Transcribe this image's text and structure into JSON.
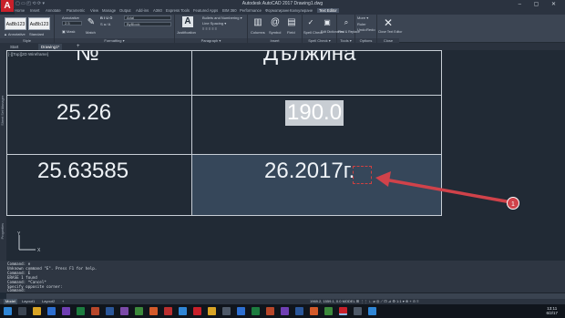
{
  "window": {
    "logo_letter": "A",
    "qat_text": "▢ ▭ ◰ ⟲ ⟳ ▾",
    "title": "Autodesk AutoCAD 2017   Drawing1.dwg",
    "controls": "– ▢ ✕"
  },
  "menu_tabs": [
    "Home",
    "Insert",
    "Annotate",
    "Parametric",
    "View",
    "Manage",
    "Output",
    "Add-ins",
    "A360",
    "Express Tools",
    "Featured Apps",
    "BIM 360",
    "Performance",
    "Форматиране",
    "Калкулиране",
    "Text Editor"
  ],
  "ribbon": {
    "style_boxes": [
      "AaBb123",
      "AaBb123"
    ],
    "style_under": [
      "▲ Annotative",
      "Standard"
    ],
    "style_panel": "Style",
    "annotative": "Annotative",
    "text_height": "2.5",
    "mask": "▣ Mask",
    "match_label": "Match",
    "font_combo": "Arial",
    "color_combo": "ByBlock",
    "formatting_panel": "Formatting ▾",
    "justification_label": "Justification",
    "bullets": "Bullets and Numbering ▾",
    "line_spacing": "Line Spacing ▾",
    "paragraph_panel": "Paragraph ▾",
    "columns_label": "Columns",
    "symbol_label": "Symbol",
    "field_label": "Field",
    "insert_panel": "Insert",
    "spell_check_label": "Spell Check",
    "dictionaries_label": "Edit Dictionaries",
    "spell_panel": "Spell Check ▾",
    "find_label": "Find & Replace",
    "tools_panel": "Tools ▾",
    "more_label": "More ▾",
    "ruler_label": "Ruler",
    "undo_label": "Undo",
    "redo_label": "Redo",
    "options_panel": "Options",
    "close_label": "Close Text Editor",
    "close_panel": "Close"
  },
  "file_tabs": [
    "Start",
    "Drawing1*"
  ],
  "viewport_label": "[-][Top][2D Wireframe]",
  "side_labels": [
    "Sheet Set Manager",
    "Properties"
  ],
  "table": {
    "header_left": "№",
    "header_right": "Дължина",
    "r1_left": "25.26",
    "r1_right": "190.0",
    "r2_left": "25.63585",
    "r2_right": "26.2017г."
  },
  "callout_number": "1",
  "ucs_x": "X",
  "ucs_y": "Y",
  "command_history": [
    "Command: e",
    "Unknown command \"E\".  Press F1 for help.",
    "Command: E",
    "ERASE 1 found",
    "Command: *Cancel*",
    "Specify opposite corner:",
    "Command:"
  ],
  "command_input": "▭-  TABLEDIT",
  "status": {
    "tabs": [
      "Model",
      "Layout1",
      "Layout2",
      "+"
    ],
    "coords": "1969.2, 1559.1, 0.0   MODEL  ⊞ ⋮⋮ ∟ ⌀ ◎ ⟋ ⊡ ⊿ ⚙  1:1 ▾  ⊕  +  ⊙  ≡"
  },
  "taskbar": {
    "time": "13:11",
    "date": "6/2/17"
  },
  "colors": {
    "accent": "#c8202a",
    "drawing_bg": "#212a35",
    "arrow": "#d0424a"
  }
}
